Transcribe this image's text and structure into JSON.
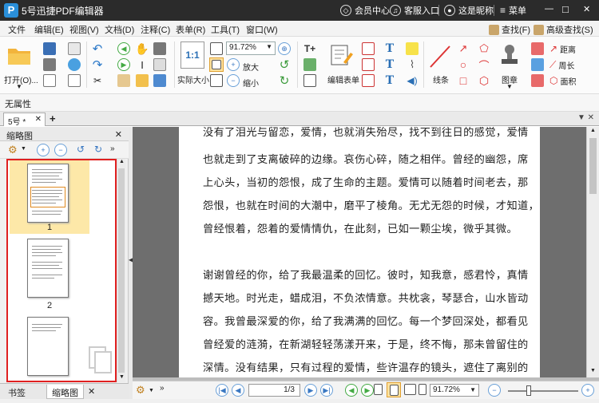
{
  "app": {
    "title": "5号迅捷PDF编辑器",
    "logo_letter": "P"
  },
  "titlebar": {
    "vip": "会员中心",
    "service": "客服入口",
    "user": "这是昵称",
    "menu": "菜单",
    "minimize": "—",
    "maximize": "□",
    "close": "✕"
  },
  "menubar": {
    "items": [
      "文件",
      "编辑(E)",
      "视图(V)",
      "文档(D)",
      "注释(C)",
      "表单(R)",
      "工具(T)",
      "窗口(W)"
    ],
    "search": "查找(F)",
    "advanced_search": "高级查找(S)"
  },
  "ribbon": {
    "open_label": "打开(O)...",
    "actual_size_label": "实际大小",
    "zoom_value": "91.72%",
    "zoom_in_label": "放大",
    "zoom_out_label": "缩小",
    "edit_form_label": "编辑表单",
    "lines_label": "线条",
    "stamp_label": "图章",
    "distance_label": "距离",
    "perimeter_label": "周长",
    "area_label": "面积"
  },
  "properties": {
    "label": "无属性"
  },
  "tabs": {
    "doc_tab": "5号 *",
    "close": "✕",
    "add": "+",
    "tab_list": "▼ ✕"
  },
  "thumbnail_panel": {
    "title": "缩略图",
    "close": "✕",
    "pages": [
      {
        "number": "1"
      },
      {
        "number": "2"
      }
    ],
    "bottom_tabs": [
      "书签",
      "缩略图"
    ],
    "tab_close": "✕"
  },
  "document": {
    "lines": [
      "没有了泪光与留恋，爱情，也就消失殆尽，找不到往日的感觉，爱情",
      "也就走到了支离破碎的边缘。哀伤心碎，随之相伴。曾经的幽怨，席",
      "上心头，当初的怨恨，成了生命的主题。爱情可以随着时间老去，那",
      "怨恨，也就在时间的大潮中，磨平了棱角。无尤无怨的时候，才知道，",
      "曾经恨着，怨着的爱情情仇，在此刻，已如一颗尘埃，微乎其微。",
      "谢谢曾经的你，给了我最温柔的回忆。彼时，知我意，感君怜，真情",
      "撼天地。时光走，蜡成泪，不负浓情意。共枕衾，琴瑟合，山水皆动",
      "容。我曾最深爱的你，给了我满满的回忆。每一个梦回深处，都看见",
      "曾经爱的涟漪，在新湖轻轻荡漾开来，于是，终不悔，那未曾留住的",
      "深情。没有结果，只有过程的爱情，些许温存的镜头，遮住了离别的"
    ]
  },
  "statusbar": {
    "page_value": "1",
    "page_total": "/3",
    "zoom_value": "91.72%"
  },
  "colors": {
    "titlebar_bg": "#2b2b2b",
    "accent": "#2a8fd9",
    "thumb_border": "#e02020",
    "selected_thumb": "#fde8a8"
  }
}
